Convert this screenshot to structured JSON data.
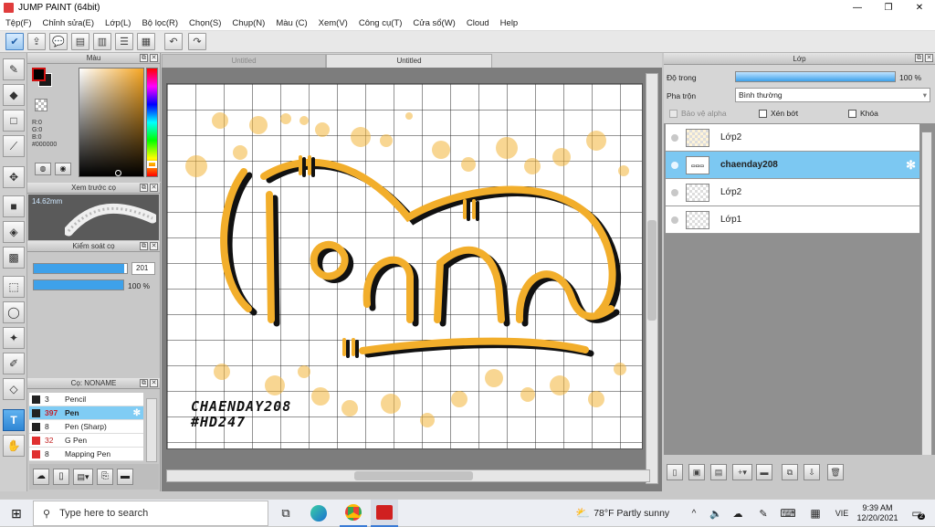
{
  "app": {
    "title": "JUMP PAINT (64bit)"
  },
  "window_controls": {
    "minimize": "—",
    "maximize": "❐",
    "close": "✕"
  },
  "menu": [
    "Tệp(F)",
    "Chỉnh sửa(E)",
    "Lớp(L)",
    "Bộ lọc(R)",
    "Chọn(S)",
    "Chụp(N)",
    "Màu (C)",
    "Xem(V)",
    "Công cụ(T)",
    "Cửa sổ(W)",
    "Cloud",
    "Help"
  ],
  "color_panel": {
    "title": "Màu",
    "r": "R:0",
    "g": "G:0",
    "b": "B:0",
    "hex": "#000000"
  },
  "brush_preview": {
    "title": "Xem trước cọ",
    "size": "14.62mm"
  },
  "brush_control": {
    "title": "Kiểm soát cọ",
    "size_value": "201",
    "opacity_value": "100 %",
    "size_fill": 0.97,
    "opacity_fill": 1.0
  },
  "brush_list": {
    "title": "Cọ: NONAME",
    "items": [
      {
        "count": "3",
        "name": "Pencil",
        "color": "#222222"
      },
      {
        "count": "397",
        "name": "Pen",
        "color": "#222222",
        "selected": true
      },
      {
        "count": "8",
        "name": "Pen (Sharp)",
        "color": "#222222"
      },
      {
        "count": "32",
        "name": "G Pen",
        "color": "#e03030"
      },
      {
        "count": "8",
        "name": "Mapping Pen",
        "color": "#e03030"
      }
    ]
  },
  "canvas_tabs": [
    "Untitled",
    "Untitled"
  ],
  "artwork": {
    "big_text": "Đàn",
    "signature_line1": "CHAENDAY208",
    "signature_line2": "#HD247"
  },
  "layer_panel": {
    "title": "Lớp",
    "opacity_label": "Độ trong",
    "opacity_value": "100 %",
    "opacity_fill": 1.0,
    "blend_label": "Pha trộn",
    "blend_value": "Bình thường",
    "protect_alpha": "Bảo vệ alpha",
    "clipping": "Xén bớt",
    "lock": "Khóa",
    "layers": [
      {
        "name": "Lớp2"
      },
      {
        "name": "chaenday208",
        "selected": true
      },
      {
        "name": "Lớp2"
      },
      {
        "name": "Lớp1"
      }
    ]
  },
  "taskbar": {
    "search_placeholder": "Type here to search",
    "weather": "78°F  Partly sunny",
    "lang": "VIE",
    "time": "9:39 AM",
    "date": "12/20/2021",
    "notifications": "2"
  }
}
